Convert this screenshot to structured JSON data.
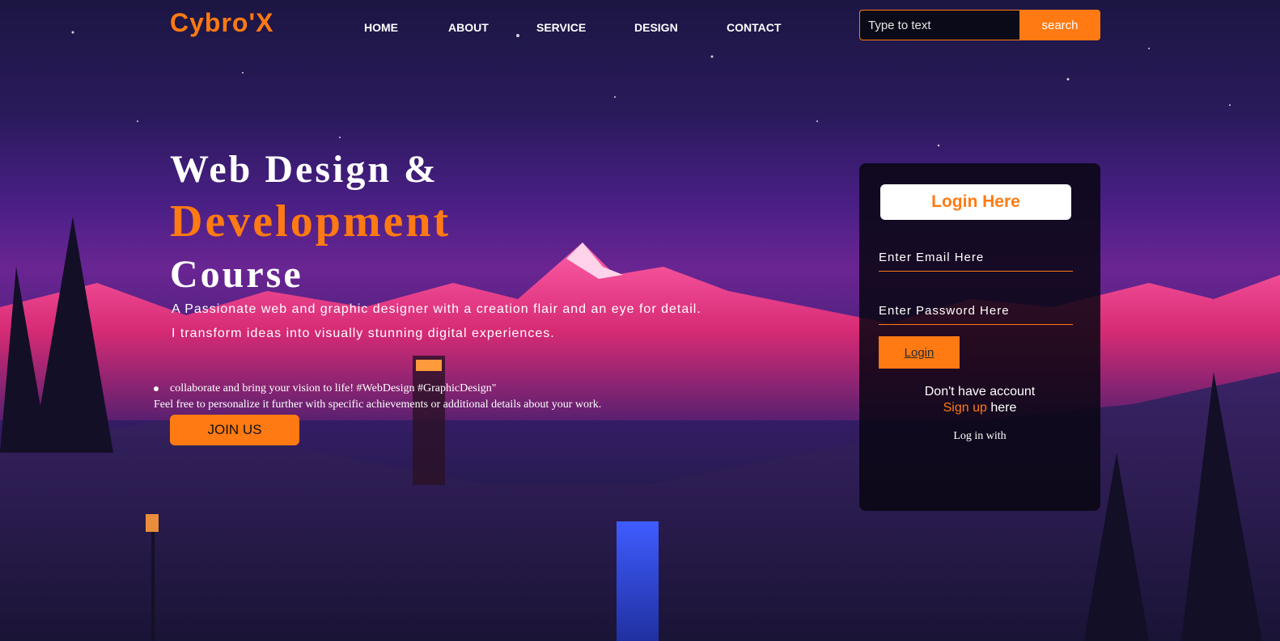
{
  "brand": {
    "logo": "Cybro'X",
    "accent": "#ff7a12"
  },
  "nav": {
    "items": [
      "HOME",
      "ABOUT",
      "SERVICE",
      "DESIGN",
      "CONTACT"
    ]
  },
  "search": {
    "placeholder": "Type to text",
    "button": "search"
  },
  "hero": {
    "line1": "Web Design &",
    "line2": "Development",
    "line3": "Course",
    "desc1": "A Passionate web and graphic designer with a creation flair and an eye for detail.",
    "desc2": "I transform ideas into visually stunning digital experiences.",
    "bullet": "collaborate and bring your vision to life! #WebDesign #GraphicDesign\"",
    "note": "Feel free to personalize it further with specific achievements or additional details about your work.",
    "join": "JOIN US"
  },
  "login": {
    "title": "Login Here",
    "email_placeholder": "Enter Email Here",
    "password_placeholder": "Enter Password Here",
    "button": "Login",
    "no_account": "Don't have account",
    "signup_link": "Sign up",
    "signup_suffix": " here",
    "login_with": "Log in with"
  }
}
